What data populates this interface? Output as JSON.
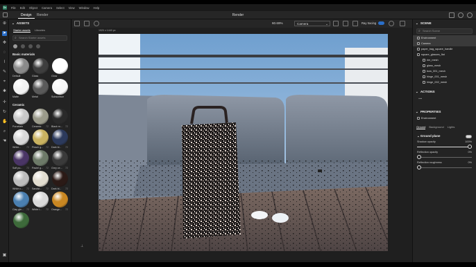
{
  "menubar": {
    "logo": "Dn",
    "items": [
      "File",
      "Edit",
      "Object",
      "Camera",
      "Select",
      "View",
      "Window",
      "Help"
    ]
  },
  "topbar": {
    "tabs": [
      "Design",
      "Render"
    ],
    "active_tab": "Design",
    "title": "Render"
  },
  "assets": {
    "header": "ASSETS",
    "subtabs": [
      "Starter assets",
      "Libraries"
    ],
    "search_placeholder": "Search Starter assets",
    "basic_title": "Basic materials",
    "basic": [
      {
        "name": "Default",
        "n": "",
        "color": "#8a8a8a"
      },
      {
        "name": "Glass",
        "n": "",
        "color": "#3e3e3e"
      },
      {
        "name": "Glow",
        "n": "",
        "color": "#ffffff"
      },
      {
        "name": "Matte",
        "n": "",
        "color": "#f2f2f2"
      },
      {
        "name": "Metal",
        "n": "",
        "color": "#5a5a5a"
      },
      {
        "name": "Subsurface",
        "n": "",
        "color": "#f6f6f6"
      }
    ],
    "ceramic_title": "Ceramic",
    "ceramic": [
      {
        "name": "Porcelain",
        "n": "",
        "color": "#c8c8c8"
      },
      {
        "name": "Ceramic",
        "n": "72",
        "color": "#9a9a8a"
      },
      {
        "name": "Black m...",
        "n": "72",
        "color": "#2a2a2a"
      },
      {
        "name": "White...",
        "n": "72",
        "color": "#d8d8d8"
      },
      {
        "name": "Peach g...",
        "n": "72",
        "color": "#c9b260"
      },
      {
        "name": "Dark bl...",
        "n": "72",
        "color": "#2c3a5c"
      },
      {
        "name": "Soft pu...",
        "n": "72",
        "color": "#4a3566"
      },
      {
        "name": "Pastel g...",
        "n": "72",
        "color": "#6d7a68"
      },
      {
        "name": "Grey ce...",
        "n": "72",
        "color": "#3a3a3a"
      },
      {
        "name": "White c...",
        "n": "72",
        "color": "#bdbdbd"
      },
      {
        "name": "Sandst...",
        "n": "72",
        "color": "#e2ddd0"
      },
      {
        "name": "Dark bl...",
        "n": "72",
        "color": "#2b1a16"
      },
      {
        "name": "Clay gle...",
        "n": "72",
        "color": "#4a7fb0"
      },
      {
        "name": "White l...",
        "n": "72",
        "color": "#d9d9d9"
      },
      {
        "name": "Orange...",
        "n": "72",
        "color": "#c98722"
      },
      {
        "name": "",
        "n": "",
        "color": "#3d6a3a"
      }
    ]
  },
  "viewport": {
    "zoom": "60.69%",
    "camera": "Camera",
    "ray_tracing": "Ray tracing",
    "dimensions": "1920 x 1440 px"
  },
  "scene": {
    "header": "SCENE",
    "search_placeholder": "Search Scene",
    "items": [
      {
        "label": "Environment",
        "sel": true
      },
      {
        "label": "Camera",
        "sel": true
      },
      {
        "label": "paper_bag_square_handle",
        "sel": false
      },
      {
        "label": "square_glasses_flat",
        "sel": false
      },
      {
        "label": "rim_mesh",
        "sel": false
      },
      {
        "label": "glass_mesh",
        "sel": false
      },
      {
        "label": "bow_001_mesh",
        "sel": false
      },
      {
        "label": "hinge_001_mesh",
        "sel": false
      },
      {
        "label": "hinge_002_mesh",
        "sel": false
      }
    ]
  },
  "actions": {
    "header": "ACTIONS"
  },
  "properties": {
    "header": "PROPERTIES",
    "object": "Environment",
    "subtabs": [
      "Ground",
      "Background",
      "Lights"
    ],
    "section": "Ground plane",
    "sliders": [
      {
        "label": "Shadow opacity",
        "value": "100%",
        "level": 1.0
      },
      {
        "label": "Reflection opacity",
        "value": "0%",
        "level": 0.0
      },
      {
        "label": "Reflection roughness",
        "value": "0%",
        "level": 0.0
      }
    ]
  },
  "colors": {
    "accent": "#2a6fc9",
    "panel": "#232323"
  }
}
